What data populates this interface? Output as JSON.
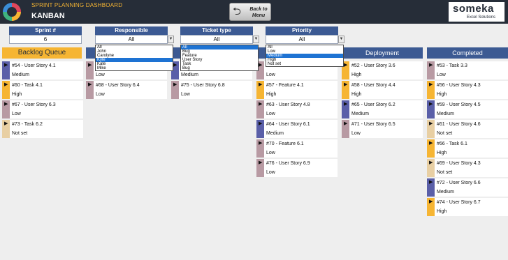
{
  "header": {
    "title": "SPRINT PLANNING DASHBOARD",
    "subtitle": "KANBAN",
    "back_line1": "Back to",
    "back_line2": "Menu",
    "brand_name": "someka",
    "brand_tag": "Excel Solutions"
  },
  "colors": {
    "high": "#f6b533",
    "medium": "#5a5fa8",
    "low": "#b89aa3",
    "notset": "#e8cfa3",
    "header_bg": "#262d38",
    "accent": "#3c5a93"
  },
  "filters": {
    "sprint": {
      "label": "Sprint #",
      "value": "6"
    },
    "responsible": {
      "label": "Responsible",
      "value": "All",
      "options": [
        "All",
        "John",
        "Carolyne",
        "Kyle",
        "Kate",
        "Mike"
      ]
    },
    "ticket_type": {
      "label": "Ticket type",
      "value": "All",
      "options": [
        "All",
        "Bug",
        "Feature",
        "User Story",
        "Task",
        "Bug"
      ]
    },
    "priority": {
      "label": "Priority",
      "value": "All",
      "options": [
        "All",
        "Low",
        "Medium",
        "High",
        "Not set"
      ]
    }
  },
  "columns": [
    {
      "name": "Backlog Queue",
      "cards": [
        {
          "title": "#54 - User Story 4.1",
          "priority": "Medium"
        },
        {
          "title": "#60 - Task 4.1",
          "priority": "High"
        },
        {
          "title": "#67 - User Story 6.3",
          "priority": "Low"
        },
        {
          "title": "#73 - Task 6.2",
          "priority": "Not set"
        }
      ]
    },
    {
      "name": "",
      "cards": [
        {
          "title": "",
          "priority": "Low"
        },
        {
          "title": "#68 - User Story 6.4",
          "priority": "Low"
        }
      ]
    },
    {
      "name": "",
      "cards": [
        {
          "title": "",
          "priority": "Medium"
        },
        {
          "title": "#75 - User Story 6.8",
          "priority": "Low"
        }
      ]
    },
    {
      "name": "",
      "cards": [
        {
          "title": "",
          "priority": "Low"
        },
        {
          "title": "#57 - Feature 4.1",
          "priority": "High"
        },
        {
          "title": "#63 - User Story 4.8",
          "priority": "Low"
        },
        {
          "title": "#64 - User Story 6.1",
          "priority": "Medium"
        },
        {
          "title": "#70 - Feature 6.1",
          "priority": "Low"
        },
        {
          "title": "#76 - User Story 6.9",
          "priority": "Low"
        }
      ]
    },
    {
      "name": "Deployment",
      "cards": [
        {
          "title": "#52 - User Story 3.6",
          "priority": "High"
        },
        {
          "title": "#58 - User Story 4.4",
          "priority": "High"
        },
        {
          "title": "#65 - User Story 6.2",
          "priority": "Medium"
        },
        {
          "title": "#71 - User Story 6.5",
          "priority": "Low"
        }
      ]
    },
    {
      "name": "Completed",
      "cards": [
        {
          "title": "#53 - Task 3.3",
          "priority": "Low"
        },
        {
          "title": "#56 - User Story 4.3",
          "priority": "High"
        },
        {
          "title": "#59 - User Story 4.5",
          "priority": "Medium"
        },
        {
          "title": "#61 - User Story 4.6",
          "priority": "Not set"
        },
        {
          "title": "#66 - Task 6.1",
          "priority": "High"
        },
        {
          "title": "#69 - User Story 4.3",
          "priority": "Not set"
        },
        {
          "title": "#72 - User Story 6.6",
          "priority": "Medium"
        },
        {
          "title": "#74 - User Story 6.7",
          "priority": "High"
        }
      ]
    }
  ]
}
